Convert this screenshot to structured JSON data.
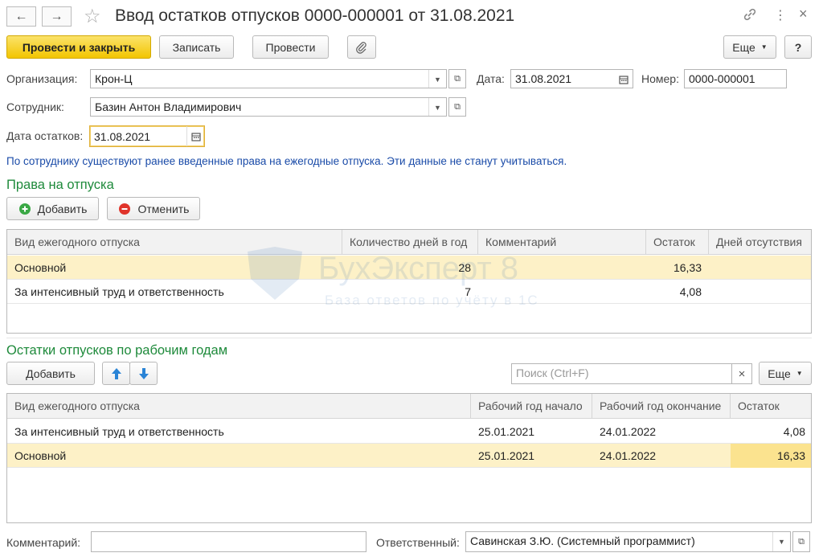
{
  "window": {
    "title": "Ввод остатков отпусков 0000-000001 от 31.08.2021",
    "back_icon": "←",
    "forward_icon": "→",
    "link_icon": "link-icon",
    "more_icon": "⋮",
    "close_icon": "×"
  },
  "toolbar": {
    "post_close": "Провести и закрыть",
    "save": "Записать",
    "post": "Провести",
    "more": "Еще",
    "help": "?"
  },
  "form": {
    "org_label": "Организация:",
    "org_value": "Крон-Ц",
    "date_label": "Дата:",
    "date_value": "31.08.2021",
    "number_label": "Номер:",
    "number_value": "0000-000001",
    "employee_label": "Сотрудник:",
    "employee_value": "Базин Антон Владимирович",
    "balance_date_label": "Дата остатков:",
    "balance_date_value": "31.08.2021"
  },
  "info_message": "По сотруднику существуют ранее введенные права на ежегодные отпуска. Эти данные не станут учитываться.",
  "rights": {
    "section_title": "Права на отпуска",
    "add_label": "Добавить",
    "cancel_label": "Отменить",
    "columns": [
      "Вид ежегодного отпуска",
      "Количество дней в год",
      "Комментарий",
      "Остаток",
      "Дней отсутствия"
    ],
    "rows": [
      {
        "type": "Основной",
        "days": "28",
        "comment": "",
        "balance": "16,33",
        "absence": ""
      },
      {
        "type": "За интенсивный труд и ответственность",
        "days": "7",
        "comment": "",
        "balance": "4,08",
        "absence": ""
      }
    ]
  },
  "balances": {
    "section_title": "Остатки отпусков по рабочим годам",
    "add_label": "Добавить",
    "search_placeholder": "Поиск (Ctrl+F)",
    "clear_icon": "×",
    "more": "Еще",
    "columns": [
      "Вид ежегодного отпуска",
      "Рабочий год начало",
      "Рабочий год окончание",
      "Остаток"
    ],
    "rows": [
      {
        "type": "За интенсивный труд и ответственность",
        "start": "25.01.2021",
        "end": "24.01.2022",
        "balance": "4,08"
      },
      {
        "type": "Основной",
        "start": "25.01.2021",
        "end": "24.01.2022",
        "balance": "16,33"
      }
    ]
  },
  "footer": {
    "comment_label": "Комментарий:",
    "comment_value": "",
    "responsible_label": "Ответственный:",
    "responsible_value": "Савинская З.Ю. (Системный программист)"
  },
  "watermark": {
    "brand": "БухЭксперт 8",
    "tagline": "База ответов по учёту в 1С"
  },
  "colors": {
    "accent_yellow": "#f2c500",
    "section_green": "#1e8a3b",
    "info_blue": "#1a4ba8",
    "selected_row": "#fdf1c7"
  }
}
